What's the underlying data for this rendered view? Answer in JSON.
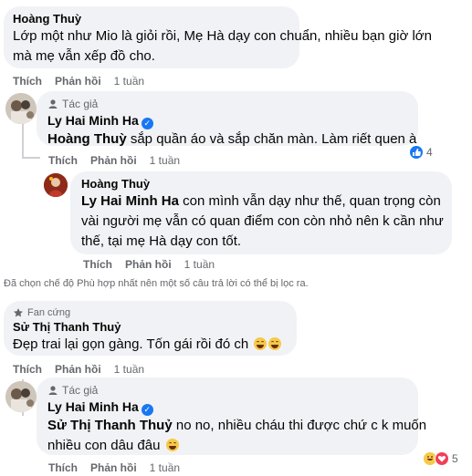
{
  "comments": [
    {
      "author": "Hoàng Thuỳ",
      "lines": [
        "Lớp một như Mio là giỏi rồi, Mẹ Hà dạy con chuẩn, nhiều bạn giờ lớn",
        "mà mẹ vẫn xếp đồ cho."
      ],
      "like_label": "Thích",
      "reply_label": "Phản hồi",
      "time": "1 tuần"
    },
    {
      "tag": "Tác giả",
      "author": "Ly Hai Minh Ha",
      "mention": "Hoàng Thuỳ",
      "text": " sắp quần áo và sắp chăn màn. Làm riết quen à",
      "like_label": "Thích",
      "reply_label": "Phản hồi",
      "time": "1 tuần",
      "reaction_count": "4"
    },
    {
      "author": "Hoàng Thuỳ",
      "mention": "Ly Hai Minh Ha",
      "line1": " con mình vẫn dạy như thế, quan trọng còn",
      "line2": "vài người mẹ vẫn có quan điểm con còn nhỏ nên k cần như",
      "line3": "thế, tại mẹ Hà dạy con tốt.",
      "like_label": "Thích",
      "reply_label": "Phản hồi",
      "time": "1 tuần"
    },
    {
      "tag": "Fan cứng",
      "author": "Sử Thị Thanh Thuỷ",
      "text": "Đẹp trai lại gọn gàng. Tốn gái rồi đó ch",
      "like_label": "Thích",
      "reply_label": "Phản hồi",
      "time": "1 tuần"
    },
    {
      "tag": "Tác giả",
      "author": "Ly Hai Minh Ha",
      "mention": "Sử Thị Thanh Thuỷ",
      "line1": " no no, nhiều cháu thi được chứ c k muốn",
      "line2": "nhiều con dâu đâu",
      "like_label": "Thích",
      "reply_label": "Phản hồi",
      "time": "1 tuần",
      "reaction_count": "5"
    }
  ],
  "filter_notice": "Đã chọn chế độ Phù hợp nhất nên một số câu trả lời có thể bị lọc ra.",
  "colors": {
    "bubble": "#f0f2f5",
    "secondary_text": "#65676b",
    "verified": "#1877f2"
  },
  "icons": [
    "verified-badge-icon",
    "like-reaction-icon",
    "haha-reaction-icon",
    "love-reaction-icon",
    "laughing-emoji-icon",
    "fan-badge-icon",
    "author-badge-icon"
  ]
}
